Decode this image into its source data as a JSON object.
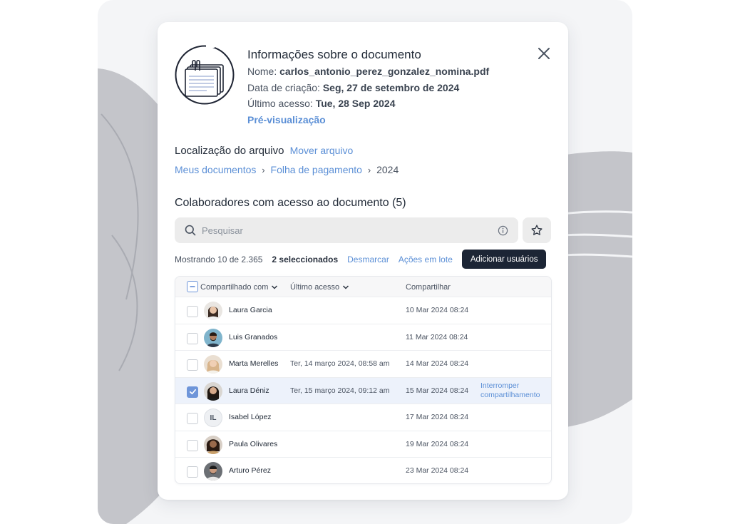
{
  "header": {
    "title": "Informações sobre o documento",
    "name_label": "Nome:",
    "name_value": "carlos_antonio_perez_gonzalez_nomina.pdf",
    "created_label": "Data de criação:",
    "created_value": "Seg, 27 de setembro de 2024",
    "access_label": "Último acesso:",
    "access_value": "Tue, 28 Sep 2024",
    "preview_link": "Pré-visualização",
    "icons": {
      "document": "document-stack-icon",
      "close": "close-icon"
    }
  },
  "location": {
    "label": "Localização do arquivo",
    "move_link": "Mover arquivo",
    "breadcrumb": [
      "Meus documentos",
      "Folha de pagamento",
      "2024"
    ]
  },
  "collaborators": {
    "title": "Colaboradores com acesso ao documento (5)",
    "search_placeholder": "Pesquisar",
    "showing": "Mostrando 10 de 2.365",
    "selected": "2 seleccionados",
    "unselect": "Desmarcar",
    "bulk_actions": "Ações em lote",
    "add_users": "Adicionar usuários",
    "columns": [
      "Compartilhado com",
      "Último acesso",
      "Compartilhar"
    ],
    "rows": [
      {
        "name": "Laura Garcia",
        "last_access": "",
        "shared": "10 Mar 2024 08:24",
        "checked": false,
        "avatar": "photo"
      },
      {
        "name": "Luis Granados",
        "last_access": "",
        "shared": "11 Mar 2024 08:24",
        "checked": false,
        "avatar": "photo"
      },
      {
        "name": "Marta Merelles",
        "last_access": "Ter, 14 março 2024, 08:58 am",
        "shared": "14 Mar 2024 08:24",
        "checked": false,
        "avatar": "photo"
      },
      {
        "name": "Laura Déniz",
        "last_access": "Ter, 15 março 2024, 09:12 am",
        "shared": "15 Mar 2024 08:24",
        "checked": true,
        "avatar": "photo",
        "action": [
          "Interromper",
          "compartilhamento"
        ]
      },
      {
        "name": "Isabel López",
        "last_access": "",
        "shared": "17 Mar 2024 08:24",
        "checked": false,
        "avatar": "initials",
        "initials": "IL"
      },
      {
        "name": "Paula Olivares",
        "last_access": "",
        "shared": "19 Mar 2024 08:24",
        "checked": false,
        "avatar": "photo"
      },
      {
        "name": "Arturo Pérez",
        "last_access": "",
        "shared": "23 Mar 2024 08:24",
        "checked": false,
        "avatar": "photo"
      }
    ]
  },
  "colors": {
    "accent": "#5b8fd6",
    "primary_button": "#1c2535",
    "selected_row": "#edf2fb",
    "checkbox": "#6e95d9"
  }
}
